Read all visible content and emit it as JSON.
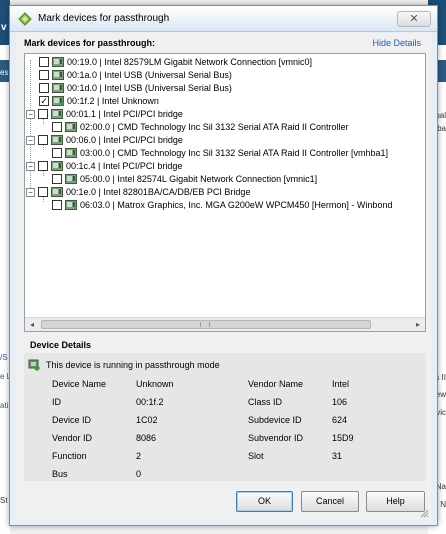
{
  "window": {
    "title": "Mark devices for passthrough",
    "close_glyph": "✕"
  },
  "section": {
    "title": "Mark devices for passthrough:",
    "hide_details": "Hide Details"
  },
  "tree": [
    {
      "label": "00:19.0 | Intel 82579LM Gigabit Network Connection [vmnic0]",
      "checked": false,
      "expander": ""
    },
    {
      "label": "00:1a.0 | Intel USB (Universal Serial Bus)",
      "checked": false,
      "expander": ""
    },
    {
      "label": "00:1d.0 | Intel USB (Universal Serial Bus)",
      "checked": false,
      "expander": ""
    },
    {
      "label": "00:1f.2 | Intel Unknown",
      "checked": true,
      "expander": ""
    },
    {
      "label": "00:01.1 | Intel PCI/PCI bridge",
      "checked": false,
      "expander": "−"
    },
    {
      "label": "02:00.0 | CMD Technology Inc Sil 3132 Serial ATA Raid II Controller",
      "checked": false,
      "expander": ""
    },
    {
      "label": "00:06.0 | Intel PCI/PCI bridge",
      "checked": false,
      "expander": "−"
    },
    {
      "label": "03:00.0 | CMD Technology Inc Sil 3132 Serial ATA Raid II Controller [vmhba1]",
      "checked": false,
      "expander": ""
    },
    {
      "label": "00:1c.4 | Intel PCI/PCI bridge",
      "checked": false,
      "expander": "−"
    },
    {
      "label": "05:00.0 | Intel 82574L Gigabit Network Connection [vmnic1]",
      "checked": false,
      "expander": ""
    },
    {
      "label": "00:1e.0 | Intel 82801BA/CA/DB/EB PCI Bridge",
      "checked": false,
      "expander": "−"
    },
    {
      "label": "06:03.0 | Matrox Graphics, Inc. MGA G200eW WPCM450 [Hermon] - Winbond",
      "checked": false,
      "expander": ""
    }
  ],
  "details": {
    "title": "Device Details",
    "status": "This device is running in passthrough mode",
    "left": [
      {
        "label": "Device Name",
        "value": "Unknown"
      },
      {
        "label": "ID",
        "value": "00:1f.2"
      },
      {
        "label": "Device ID",
        "value": "1C02"
      },
      {
        "label": "Vendor ID",
        "value": "8086"
      },
      {
        "label": "Function",
        "value": "2"
      },
      {
        "label": "Bus",
        "value": "0"
      }
    ],
    "right": [
      {
        "label": "Vendor Name",
        "value": "Intel"
      },
      {
        "label": "Class ID",
        "value": "106"
      },
      {
        "label": "Subdevice ID",
        "value": "624"
      },
      {
        "label": "Subvendor ID",
        "value": "15D9"
      },
      {
        "label": "Slot",
        "value": "31"
      }
    ]
  },
  "buttons": {
    "ok": "OK",
    "cancel": "Cancel",
    "help": "Help"
  },
  "background": {
    "left_texts": [
      "es",
      "/S",
      "e L",
      "ati",
      "St"
    ],
    "right_texts": [
      "ual",
      "ba",
      "s II",
      "ew",
      "rvic",
      "Na",
      "N"
    ],
    "top_left": "v"
  },
  "colors": {
    "accent": "#1a5fb4",
    "check_green": "#3a9a3a"
  }
}
